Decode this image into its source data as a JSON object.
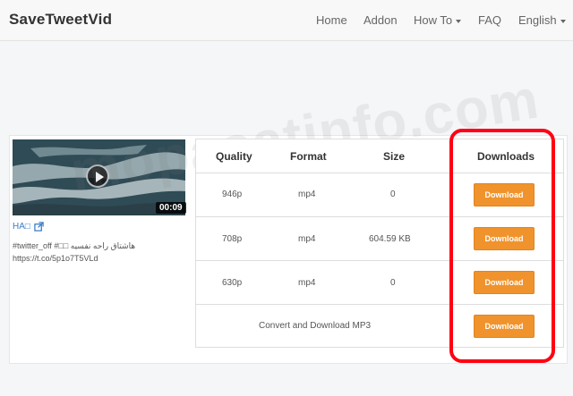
{
  "nav": {
    "brand": "SaveTweetVid",
    "items": [
      {
        "label": "Home"
      },
      {
        "label": "Addon"
      },
      {
        "label": "How To"
      },
      {
        "label": "FAQ"
      },
      {
        "label": "English"
      }
    ]
  },
  "video": {
    "duration": "00:09",
    "author": "HA□",
    "text_line1": "#twitter_off #□□ هاشتاق راحه نفسيه",
    "text_line2": "https://t.co/5p1o7T5VLd"
  },
  "table": {
    "headers": {
      "quality": "Quality",
      "format": "Format",
      "size": "Size",
      "downloads": "Downloads"
    },
    "rows": [
      {
        "quality": "946p",
        "format": "mp4",
        "size": "0",
        "button": "Download"
      },
      {
        "quality": "708p",
        "format": "mp4",
        "size": "604.59 KB",
        "button": "Download"
      },
      {
        "quality": "630p",
        "format": "mp4",
        "size": "0",
        "button": "Download"
      }
    ],
    "mp3": {
      "label": "Convert and Download MP3",
      "button": "Download"
    }
  },
  "watermark": "mopasatinfo.com",
  "colors": {
    "button": "#f0932c",
    "highlight": "#ff0014",
    "link": "#3a7ec7"
  }
}
